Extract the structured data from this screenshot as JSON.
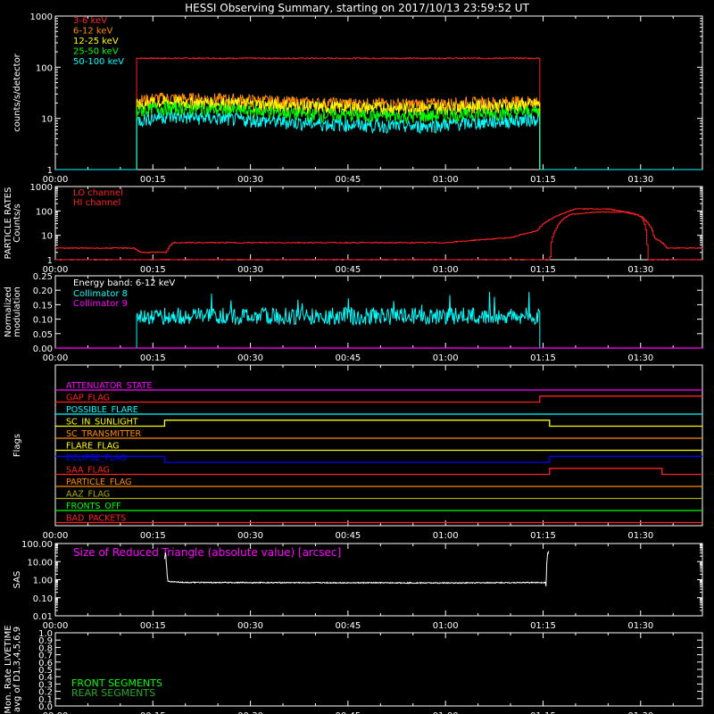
{
  "title": "HESSI Observing Summary, starting on 2017/10/13 23:59:52 UT",
  "time_ticks": [
    "00:00",
    "00:15",
    "00:30",
    "00:45",
    "01:00",
    "01:15",
    "01:30"
  ],
  "time_tick_minutes": [
    0,
    15,
    30,
    45,
    60,
    75,
    90
  ],
  "time_range_minutes": [
    0,
    99.5
  ],
  "colors": {
    "background": "#000000",
    "axis": "#ffffff",
    "red": "#ff2020",
    "orange": "#ff8c00",
    "yellow": "#ffff00",
    "green": "#00ff00",
    "cyan": "#00ffff",
    "magenta": "#ff00ff",
    "blue": "#0000ff",
    "olive": "#aaaa00",
    "dkgreen": "#22aa22"
  },
  "chart_data": [
    {
      "type": "line",
      "panel": "count-rates",
      "ylabel": "counts/s/detector",
      "yscale": "log",
      "ylim": [
        1,
        1000
      ],
      "yticks": [
        "1",
        "10",
        "100",
        "1000"
      ],
      "legend_position": "top-left",
      "active_window_minutes": [
        12.5,
        74.5
      ],
      "series": [
        {
          "name": "3-6 keV",
          "color": "#ff2020",
          "x": [
            0,
            12.5,
            74.5,
            99.5
          ],
          "y": [
            1,
            150,
            150,
            1
          ]
        },
        {
          "name": "6-12 keV",
          "color": "#ff8c00",
          "x": [
            0,
            12.5,
            16,
            25,
            40,
            55,
            70,
            74.5,
            99.5
          ],
          "y": [
            1,
            22,
            25,
            24,
            20,
            19,
            21,
            22,
            1
          ]
        },
        {
          "name": "12-25 keV",
          "color": "#ffff00",
          "x": [
            0,
            12.5,
            16,
            25,
            40,
            55,
            70,
            74.5,
            99.5
          ],
          "y": [
            1,
            18,
            21,
            20,
            17,
            16,
            18,
            19,
            1
          ]
        },
        {
          "name": "25-50 keV",
          "color": "#00ff00",
          "x": [
            0,
            12.5,
            16,
            25,
            40,
            55,
            70,
            74.5,
            99.5
          ],
          "y": [
            1,
            14,
            16,
            15,
            12,
            11,
            13,
            14,
            1
          ]
        },
        {
          "name": "50-100 keV",
          "color": "#00ffff",
          "x": [
            0,
            12.5,
            16,
            25,
            40,
            55,
            70,
            74.5,
            99.5
          ],
          "y": [
            1,
            9,
            11,
            10,
            8,
            7,
            9,
            10,
            1
          ]
        }
      ]
    },
    {
      "type": "line",
      "panel": "particle-rates",
      "ylabel": "PARTICLE RATES Counts/s",
      "yscale": "log",
      "ylim": [
        1,
        1000
      ],
      "yticks": [
        "1",
        "10",
        "100",
        "1000"
      ],
      "legend_position": "top-left",
      "series": [
        {
          "name": "LO channel",
          "color": "#ff2020",
          "x": [
            0,
            12,
            13,
            17,
            18,
            60,
            70,
            74,
            77,
            80,
            85,
            90,
            92,
            94,
            99.5
          ],
          "y": [
            3,
            3,
            2,
            2,
            5,
            5,
            8,
            15,
            60,
            120,
            120,
            60,
            8,
            3,
            3
          ]
        },
        {
          "name": "HI channel",
          "color": "#ff2020",
          "x": [
            0,
            76,
            77,
            79,
            83,
            88,
            90,
            91,
            99.5
          ],
          "y": [
            1,
            1,
            20,
            70,
            90,
            90,
            60,
            1,
            1
          ]
        }
      ]
    },
    {
      "type": "line",
      "panel": "modulation",
      "ylabel": "Normalized modulation",
      "ylim": [
        0,
        0.25
      ],
      "yticks": [
        "0.00",
        "0.05",
        "0.10",
        "0.15",
        "0.20",
        "0.25"
      ],
      "annotation": "Energy band: 6-12 keV",
      "legend_position": "top-left",
      "active_window_minutes": [
        12.5,
        74.5
      ],
      "series": [
        {
          "name": "Collimator 8",
          "color": "#00ffff",
          "x": [
            0,
            12.5,
            74.5,
            99.5
          ],
          "y": [
            0,
            0.11,
            0.11,
            0
          ]
        },
        {
          "name": "Collimator 9",
          "color": "#ff00ff",
          "x": [
            0,
            99.5
          ],
          "y": [
            0,
            0
          ]
        }
      ]
    },
    {
      "type": "line",
      "panel": "flags",
      "ylabel": "Flags",
      "series": [
        {
          "name": "ATTENUATOR_STATE",
          "color": "#ff00ff",
          "x": [
            0,
            99.5
          ],
          "y": [
            0,
            0
          ]
        },
        {
          "name": "GAP_FLAG",
          "color": "#ff2020",
          "x": [
            0,
            74.5,
            99.5
          ],
          "y": [
            0,
            1,
            1
          ]
        },
        {
          "name": "POSSIBLE_FLARE",
          "color": "#00ffff",
          "x": [
            0,
            99.5
          ],
          "y": [
            0,
            0
          ]
        },
        {
          "name": "SC_IN_SUNLIGHT",
          "color": "#ffff00",
          "x": [
            0,
            16.8,
            76,
            99.5
          ],
          "y": [
            0,
            1,
            0,
            0
          ]
        },
        {
          "name": "SC_TRANSMITTER",
          "color": "#ff8c00",
          "x": [
            0,
            99.5
          ],
          "y": [
            0,
            0
          ]
        },
        {
          "name": "FLARE_FLAG",
          "color": "#ffff00",
          "x": [
            0,
            99.5
          ],
          "y": [
            0,
            0
          ]
        },
        {
          "name": "ECLIPSE_FLAG",
          "color": "#0000ff",
          "x": [
            0,
            16.8,
            76,
            99.5
          ],
          "y": [
            1,
            0,
            1,
            1
          ]
        },
        {
          "name": "SAA_FLAG",
          "color": "#ff2020",
          "x": [
            0,
            76,
            93.3,
            99.5
          ],
          "y": [
            0,
            1,
            0,
            0
          ]
        },
        {
          "name": "PARTICLE_FLAG",
          "color": "#ff8c00",
          "x": [
            0,
            99.5
          ],
          "y": [
            0,
            0
          ]
        },
        {
          "name": "AAZ_FLAG",
          "color": "#aaaa00",
          "x": [
            0,
            99.5
          ],
          "y": [
            0,
            0
          ]
        },
        {
          "name": "FRONTS_OFF",
          "color": "#00ff00",
          "x": [
            0,
            99.5
          ],
          "y": [
            0,
            0
          ]
        },
        {
          "name": "BAD_PACKETS",
          "color": "#ff2020",
          "x": [
            0,
            99.5
          ],
          "y": [
            0,
            0
          ]
        }
      ]
    },
    {
      "type": "line",
      "panel": "sas",
      "ylabel": "SAS",
      "yscale": "log",
      "ylim": [
        0.01,
        100
      ],
      "yticks": [
        "0.01",
        "0.10",
        "1.00",
        "10.00",
        "100.00"
      ],
      "annotation": "Size of Reduced Triangle (absolute value) [arcsec]",
      "series": [
        {
          "color": "#ffffff",
          "x": [
            16.8,
            17.2,
            20,
            40,
            60,
            75.5,
            75.9
          ],
          "y": [
            40,
            0.8,
            0.7,
            0.68,
            0.66,
            0.7,
            40
          ]
        }
      ]
    },
    {
      "type": "line",
      "panel": "livetime",
      "ylabel": "Mon. Rate LIVETIME avg of D1,3,4,5,6,9",
      "ylim": [
        0,
        1
      ],
      "yticks": [
        "0.0",
        "0.1",
        "0.2",
        "0.3",
        "0.4",
        "0.5",
        "0.6",
        "0.7",
        "0.8",
        "0.9",
        "1.0"
      ],
      "series": [
        {
          "name": "FRONT SEGMENTS",
          "color": "#00ff00",
          "x": [],
          "y": []
        },
        {
          "name": "REAR SEGMENTS",
          "color": "#22aa22",
          "x": [],
          "y": []
        }
      ]
    }
  ]
}
